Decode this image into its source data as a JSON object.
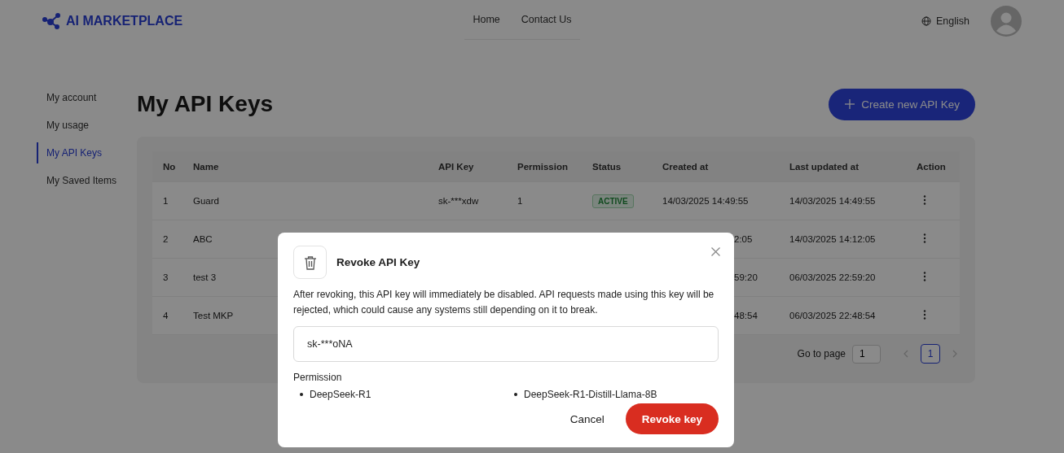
{
  "header": {
    "logo": "AI MARKETPLACE",
    "nav": [
      {
        "label": "Home"
      },
      {
        "label": "Contact Us"
      }
    ],
    "language": "English"
  },
  "sidebar": {
    "items": [
      {
        "label": "My account",
        "selected": false
      },
      {
        "label": "My usage",
        "selected": false
      },
      {
        "label": "My API Keys",
        "selected": true
      },
      {
        "label": "My Saved Items",
        "selected": false
      }
    ]
  },
  "page": {
    "title": "My API Keys",
    "create_button": "Create new API Key"
  },
  "table": {
    "columns": [
      "No",
      "Name",
      "API Key",
      "Permission",
      "Status",
      "Created at",
      "Last updated at",
      "Action"
    ],
    "rows": [
      {
        "no": "1",
        "name": "Guard",
        "api_key": "sk-***xdw",
        "permission": "1",
        "status": {
          "label": "ACTIVE",
          "kind": "active"
        },
        "created_at": "14/03/2025 14:49:55",
        "last_updated_at": "14/03/2025 14:49:55"
      },
      {
        "no": "2",
        "name": "ABC",
        "created_at_tail": "2:05",
        "last_updated_at": "14/03/2025 14:12:05"
      },
      {
        "no": "3",
        "name": "test 3",
        "created_at_tail": "59:20",
        "last_updated_at": "06/03/2025 22:59:20"
      },
      {
        "no": "4",
        "name": "Test MKP",
        "created_at_tail": "48:54",
        "last_updated_at": "06/03/2025 22:48:54"
      }
    ]
  },
  "pagination": {
    "go_to_label": "Go to page",
    "page_input": "1",
    "pages": [
      {
        "label": "1",
        "selected": true
      }
    ]
  },
  "dialog": {
    "title": "Revoke API Key",
    "message": "After revoking, this API key will immediately be disabled. API requests made using this key will be rejected, which could cause any systems still depending on it to break.",
    "key_value": "sk-***oNA",
    "permission_label": "Permission",
    "permissions": [
      "DeepSeek-R1",
      "DeepSeek-R1-Distill-Llama-8B"
    ],
    "cancel": "Cancel",
    "confirm": "Revoke key"
  }
}
